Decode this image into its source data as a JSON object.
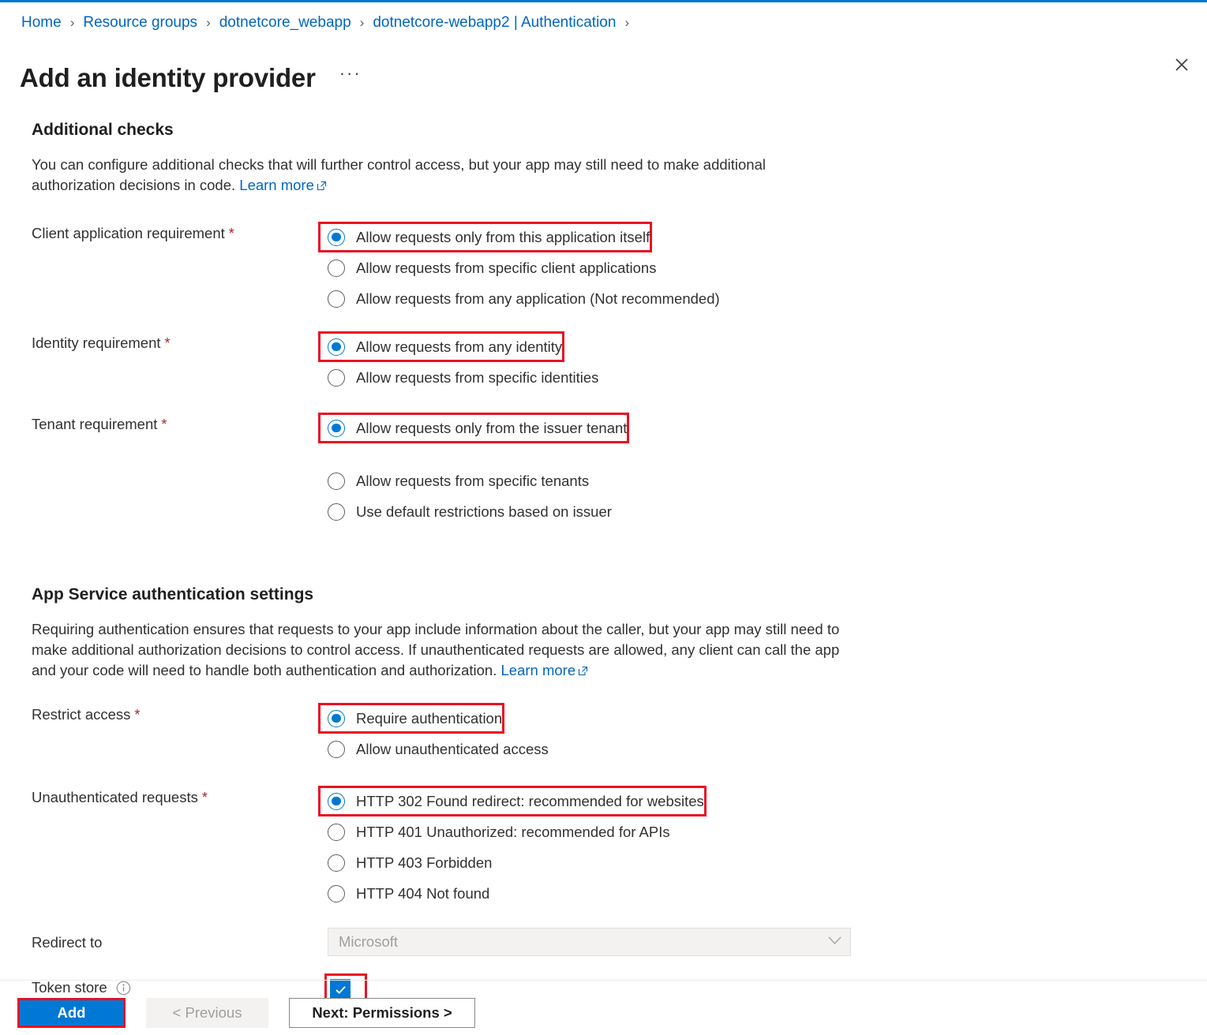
{
  "accent_color": "#0078d4",
  "highlight_color": "#e81123",
  "breadcrumb": {
    "separator": "›",
    "items": [
      "Home",
      "Resource groups",
      "dotnetcore_webapp",
      "dotnetcore-webapp2 | Authentication"
    ],
    "trailing_separator": "›"
  },
  "header": {
    "title": "Add an identity provider",
    "more_label": "···",
    "close_icon": "close-icon"
  },
  "additional_checks": {
    "heading": "Additional checks",
    "description": "You can configure additional checks that will further control access, but your app may still need to make additional authorization decisions in code.",
    "learn_more": "Learn more",
    "fields": [
      {
        "label": "Client application requirement",
        "required": true,
        "options": [
          {
            "label": "Allow requests only from this application itself",
            "selected": true,
            "highlighted": true
          },
          {
            "label": "Allow requests from specific client applications",
            "selected": false,
            "highlighted": false
          },
          {
            "label": "Allow requests from any application (Not recommended)",
            "selected": false,
            "highlighted": false
          }
        ]
      },
      {
        "label": "Identity requirement",
        "required": true,
        "options": [
          {
            "label": "Allow requests from any identity",
            "selected": true,
            "highlighted": true
          },
          {
            "label": "Allow requests from specific identities",
            "selected": false,
            "highlighted": false
          }
        ]
      },
      {
        "label": "Tenant requirement",
        "required": true,
        "options": [
          {
            "label": "Allow requests only from the issuer tenant",
            "selected": true,
            "highlighted": true,
            "gap_after": true
          },
          {
            "label": "Allow requests from specific tenants",
            "selected": false,
            "highlighted": false
          },
          {
            "label": "Use default restrictions based on issuer",
            "selected": false,
            "highlighted": false
          }
        ]
      }
    ]
  },
  "auth_settings": {
    "heading": "App Service authentication settings",
    "description": "Requiring authentication ensures that requests to your app include information about the caller, but your app may still need to make additional authorization decisions to control access. If unauthenticated requests are allowed, any client can call the app and your code will need to handle both authentication and authorization.",
    "learn_more": "Learn more",
    "fields": [
      {
        "label": "Restrict access",
        "required": true,
        "options": [
          {
            "label": "Require authentication",
            "selected": true,
            "highlighted": true
          },
          {
            "label": "Allow unauthenticated access",
            "selected": false,
            "highlighted": false
          }
        ]
      },
      {
        "label": "Unauthenticated requests",
        "required": true,
        "options": [
          {
            "label": "HTTP 302 Found redirect: recommended for websites",
            "selected": true,
            "highlighted": true
          },
          {
            "label": "HTTP 401 Unauthorized: recommended for APIs",
            "selected": false,
            "highlighted": false
          },
          {
            "label": "HTTP 403 Forbidden",
            "selected": false,
            "highlighted": false
          },
          {
            "label": "HTTP 404 Not found",
            "selected": false,
            "highlighted": false
          }
        ]
      }
    ],
    "redirect_to": {
      "label": "Redirect to",
      "value": "Microsoft",
      "disabled": true,
      "chevron_icon": "chevron-down-icon"
    },
    "token_store": {
      "label": "Token store",
      "info_icon": "info-icon",
      "checked": true,
      "highlighted": true
    }
  },
  "footer": {
    "add_label": "Add",
    "previous_label": "< Previous",
    "next_label": "Next: Permissions >"
  }
}
